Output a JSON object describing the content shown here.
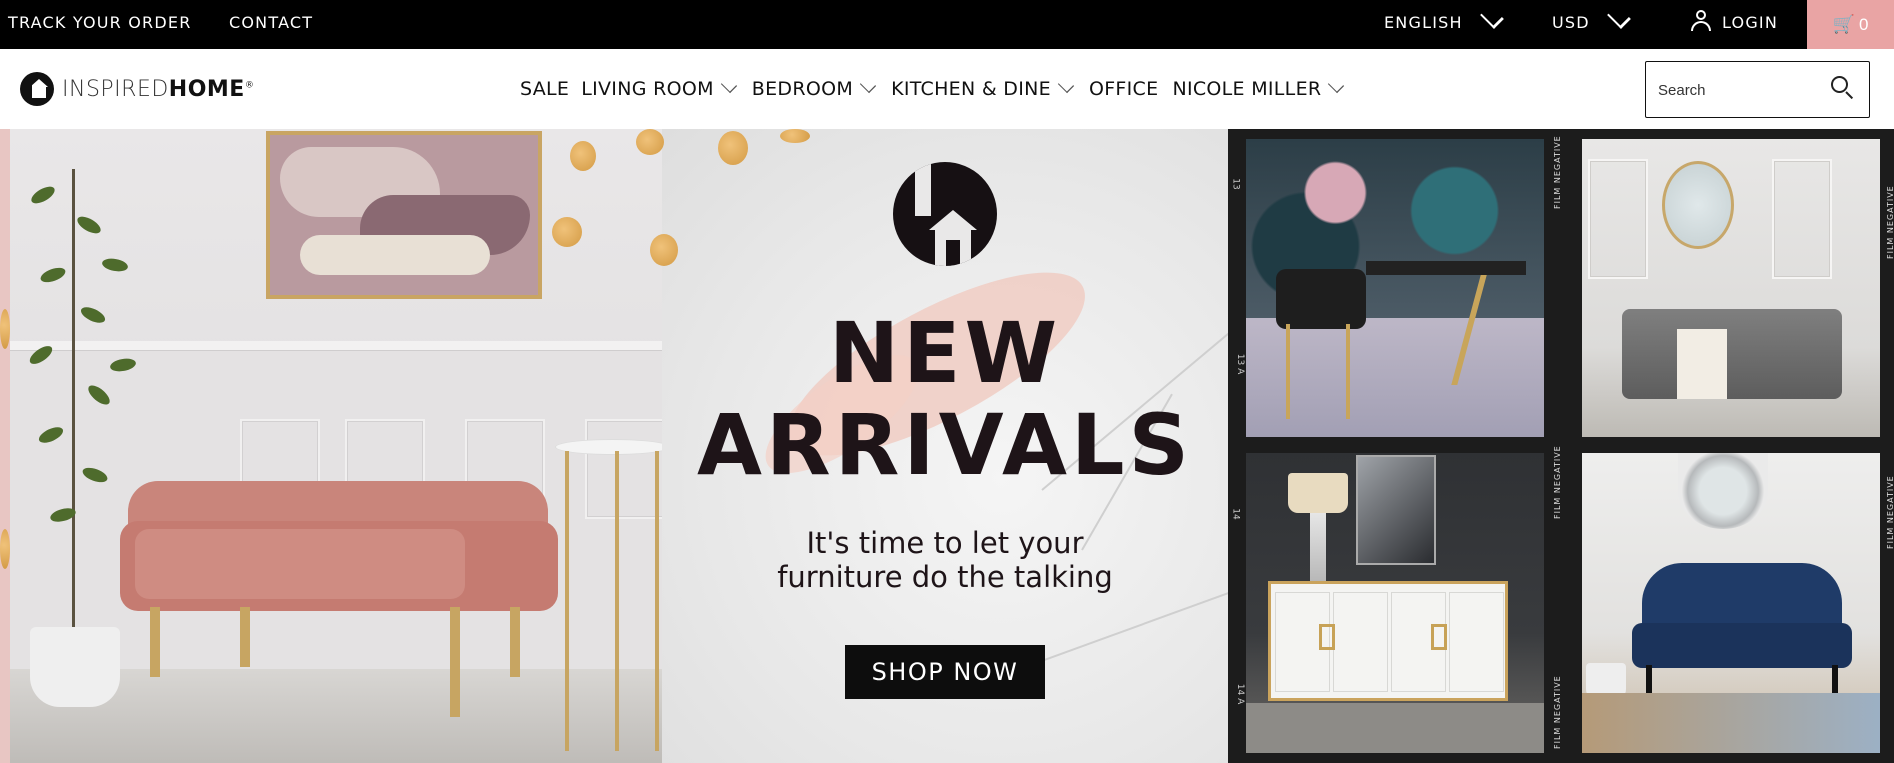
{
  "topbar": {
    "track_order": "TRACK YOUR ORDER",
    "contact": "CONTACT",
    "language": "ENGLISH",
    "currency": "USD",
    "login": "LOGIN",
    "cart_count": "0"
  },
  "header": {
    "logo_thin": "INSPIRED",
    "logo_bold": "HOME",
    "logo_reg": "®",
    "nav": [
      {
        "label": "SALE",
        "has_dropdown": false
      },
      {
        "label": "LIVING ROOM",
        "has_dropdown": true
      },
      {
        "label": "BEDROOM",
        "has_dropdown": true
      },
      {
        "label": "KITCHEN & DINE",
        "has_dropdown": true
      },
      {
        "label": "OFFICE",
        "has_dropdown": false
      },
      {
        "label": "NICOLE MILLER",
        "has_dropdown": true
      }
    ],
    "search_placeholder": "Search"
  },
  "hero": {
    "headline_line1": "NEW",
    "headline_line2": "ARRIVALS",
    "tagline_line1": "It's time to let your",
    "tagline_line2": "furniture do the talking",
    "cta": "SHOP NOW",
    "film_label": "FILM NEGATIVE",
    "film_numbers": [
      "13",
      "13 A",
      "14",
      "14 A"
    ]
  },
  "colors": {
    "topbar_bg": "#000000",
    "cart_bg": "#e9a4a4",
    "cta_bg": "#0d0d0d",
    "headline": "#1e1418"
  },
  "icons": [
    "chevron-down-icon",
    "user-icon",
    "cart-icon",
    "search-icon",
    "logo-mark"
  ]
}
